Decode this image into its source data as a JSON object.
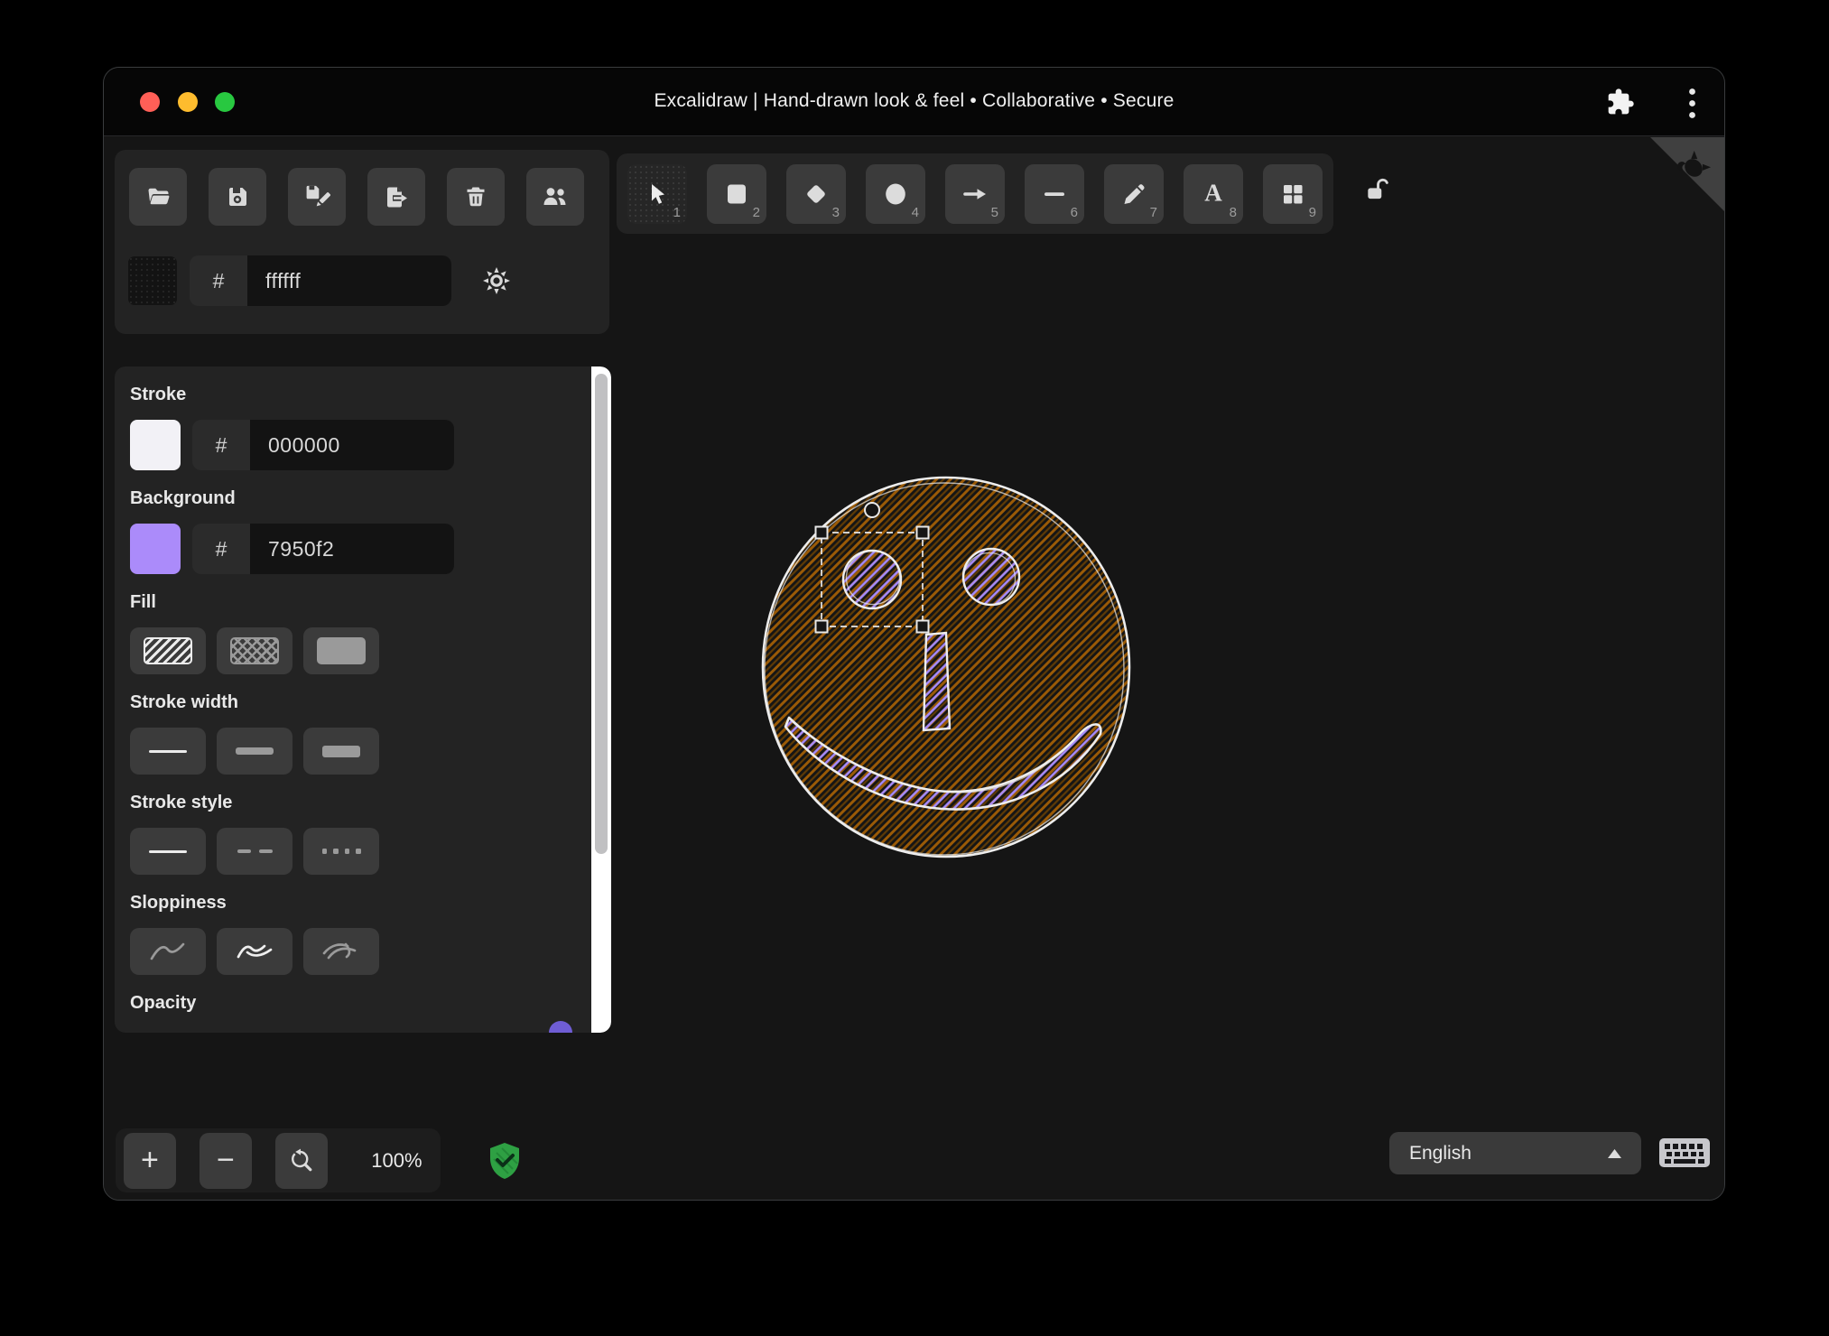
{
  "window": {
    "title": "Excalidraw | Hand-drawn look & feel • Collaborative • Secure"
  },
  "top_left_toolbar": {
    "buttons": [
      {
        "icon": "folder-open-icon"
      },
      {
        "icon": "save-icon"
      },
      {
        "icon": "save-as-icon"
      },
      {
        "icon": "export-file-icon"
      },
      {
        "icon": "trash-icon"
      },
      {
        "icon": "collaborators-icon"
      }
    ]
  },
  "canvas_background": {
    "hash": "#",
    "value": "ffffff"
  },
  "tools": [
    {
      "name": "selection",
      "shortcut": "1",
      "active": true
    },
    {
      "name": "rectangle",
      "shortcut": "2"
    },
    {
      "name": "diamond",
      "shortcut": "3"
    },
    {
      "name": "ellipse",
      "shortcut": "4"
    },
    {
      "name": "arrow",
      "shortcut": "5"
    },
    {
      "name": "line",
      "shortcut": "6"
    },
    {
      "name": "draw",
      "shortcut": "7"
    },
    {
      "name": "text",
      "shortcut": "8"
    },
    {
      "name": "shapes",
      "shortcut": "9"
    }
  ],
  "text_tool_glyph": "A",
  "panel": {
    "stroke": {
      "label": "Stroke",
      "hash": "#",
      "value": "000000"
    },
    "background": {
      "label": "Background",
      "hash": "#",
      "value": "7950f2"
    },
    "fill": {
      "label": "Fill",
      "options": [
        "hachure",
        "cross-hatch",
        "solid"
      ],
      "active": "hachure"
    },
    "stroke_width": {
      "label": "Stroke width",
      "options": [
        "thin",
        "bold",
        "extra bold"
      ],
      "active": "thin"
    },
    "stroke_style": {
      "label": "Stroke style",
      "options": [
        "solid",
        "dashed",
        "dotted"
      ],
      "active": "solid"
    },
    "sloppiness": {
      "label": "Sloppiness",
      "options": [
        "architect",
        "artist",
        "cartoonist"
      ],
      "active": "artist"
    },
    "opacity": {
      "label": "Opacity"
    }
  },
  "footer": {
    "zoom_in": "+",
    "zoom_out": "−",
    "zoom_value": "100%",
    "language": "English"
  },
  "colors": {
    "traffic_close": "#ff5f57",
    "traffic_minimize": "#febc2e",
    "traffic_zoom": "#28c840",
    "stroke_swatch": "#f2f1f6",
    "background_swatch": "#ab8bfa",
    "face_hatch": "#9a5a06",
    "face_hatch_dark": "#5e3a05",
    "element_hatch": "#a78bfa",
    "sketch_stroke": "#ededed",
    "selection": "#e8e8e8",
    "shield_green": "#2ea043"
  }
}
